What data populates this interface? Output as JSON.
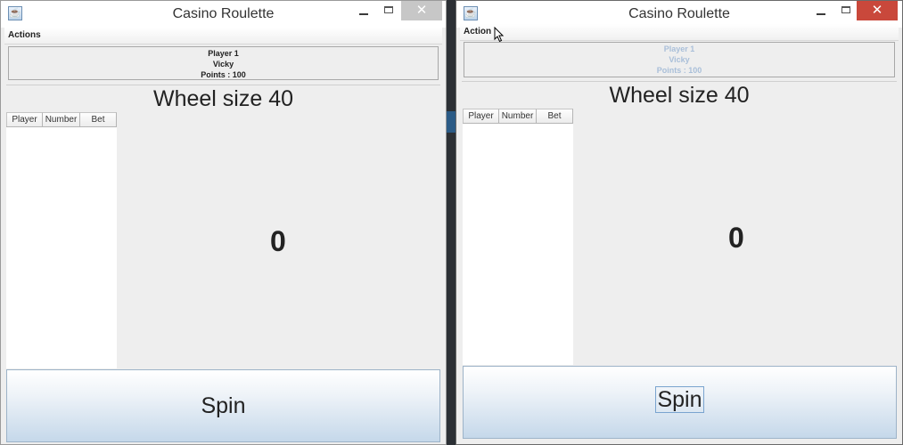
{
  "windows": [
    {
      "title": "Casino Roulette",
      "close_symbol": "✕",
      "menu": {
        "actions_label": "Actions"
      },
      "player_info": {
        "player": "Player 1",
        "name": "Vicky",
        "points": "Points : 100"
      },
      "wheel_title": "Wheel size 40",
      "table": {
        "headers": [
          "Player",
          "Number",
          "Bet"
        ],
        "rows": []
      },
      "wheel_value": "0",
      "spin_label": "Spin"
    },
    {
      "title": "Casino Roulette",
      "close_symbol": "✕",
      "menu": {
        "actions_label": "Action"
      },
      "player_info": {
        "player": "Player 1",
        "name": "Vicky",
        "points": "Points : 100"
      },
      "wheel_title": "Wheel size 40",
      "table": {
        "headers": [
          "Player",
          "Number",
          "Bet"
        ],
        "rows": []
      },
      "wheel_value": "0",
      "spin_label": "Spin"
    }
  ],
  "icons": {
    "app": "java-coffee-icon",
    "cursor": "mouse-pointer-icon"
  },
  "colors": {
    "close_active": "#c9483b",
    "close_inactive": "#c7c7c7",
    "disabled_text": "#a9bfd9"
  }
}
